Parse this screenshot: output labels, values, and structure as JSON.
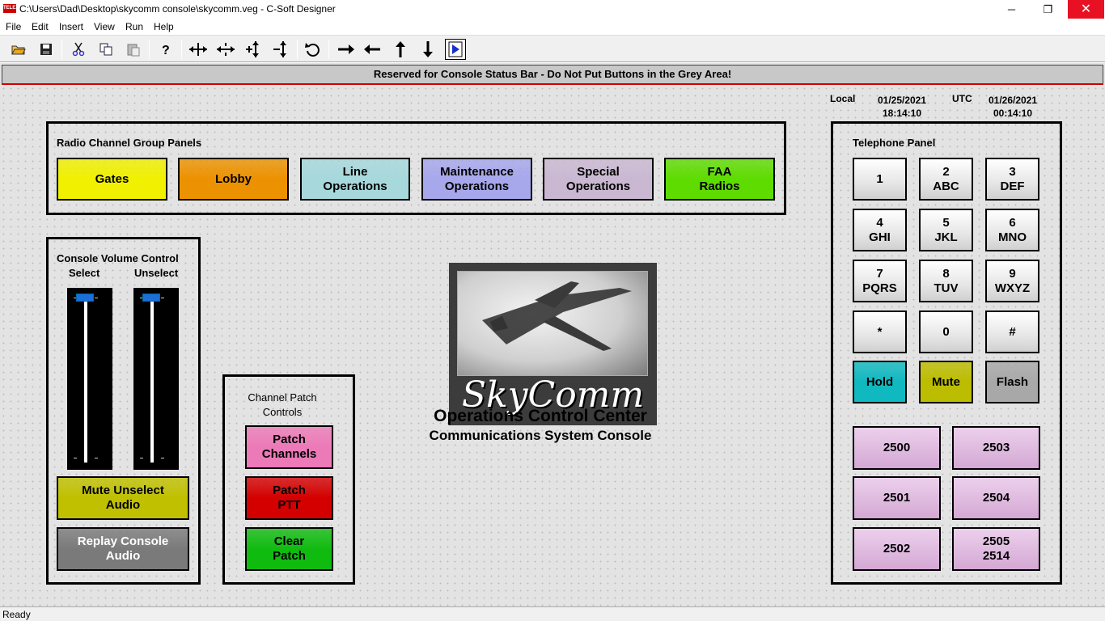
{
  "window": {
    "title": "C:\\Users\\Dad\\Desktop\\skycomm console\\skycomm.veg - C-Soft Designer",
    "app_icon_text": "TELEX",
    "minimize": "─",
    "maximize": "❐",
    "close": "✕"
  },
  "menu": [
    "File",
    "Edit",
    "Insert",
    "View",
    "Run",
    "Help"
  ],
  "toolbar": {
    "icons": [
      "open-folder-icon",
      "save-icon",
      "cut-icon",
      "copy-icon",
      "paste-icon",
      "help-icon",
      "widen-both-icon",
      "narrow-both-icon",
      "taller-icon",
      "shorter-icon",
      "undo-icon",
      "move-right-icon",
      "move-left-icon",
      "move-up-icon",
      "move-down-icon",
      "run-icon"
    ]
  },
  "status_reserved": "Reserved for Console Status Bar - Do Not Put Buttons in the Grey Area!",
  "clock": {
    "local_label": "Local",
    "local_date": "01/25/2021",
    "local_time": "18:14:10",
    "utc_label": "UTC",
    "utc_date": "01/26/2021",
    "utc_time": "00:14:10"
  },
  "radio_panel": {
    "title": "Radio Channel Group Panels",
    "buttons": [
      {
        "label": "Gates",
        "color": "#f0f000"
      },
      {
        "label": "Lobby",
        "color": "#ec9200"
      },
      {
        "label": "Line\nOperations",
        "color": "#a6d8dc"
      },
      {
        "label": "Maintenance\nOperations",
        "color": "#a7a7ec"
      },
      {
        "label": "Special\nOperations",
        "color": "#cab8d2"
      },
      {
        "label": "FAA\nRadios",
        "color": "#5edc00"
      }
    ]
  },
  "volume_panel": {
    "title": "Console Volume Control",
    "select_label": "Select",
    "unselect_label": "Unselect",
    "select_level": 1.0,
    "unselect_level": 1.0,
    "mute_button": {
      "label": "Mute Unselect\nAudio",
      "color": "#c0c000"
    },
    "replay_button": {
      "label": "Replay Console\nAudio",
      "color": "#7a7a7a"
    }
  },
  "patch_panel": {
    "title": "Channel Patch\nControls",
    "buttons": [
      {
        "label": "Patch\nChannels",
        "color": "#ec7ab8"
      },
      {
        "label": "Patch\nPTT",
        "color": "#d40000"
      },
      {
        "label": "Clear\nPatch",
        "color": "#10bb10"
      }
    ]
  },
  "logo": {
    "text": "SkyComm",
    "line1": "Operations Control Center",
    "line2": "Communications System Console"
  },
  "telephone_panel": {
    "title": "Telephone Panel",
    "keys": [
      "1",
      "2\nABC",
      "3\nDEF",
      "4\nGHI",
      "5\nJKL",
      "6\nMNO",
      "7\nPQRS",
      "8\nTUV",
      "9\nWXYZ",
      "*",
      "0",
      "#"
    ],
    "functions": [
      {
        "label": "Hold",
        "color": "#10b8c0"
      },
      {
        "label": "Mute",
        "color": "#bcbc00"
      },
      {
        "label": "Flash",
        "color": "#a8a8a8"
      }
    ],
    "lines": [
      "2500",
      "2503",
      "2501",
      "2504",
      "2502",
      "2505\n2514"
    ]
  },
  "statusbar": {
    "text": "Ready"
  }
}
